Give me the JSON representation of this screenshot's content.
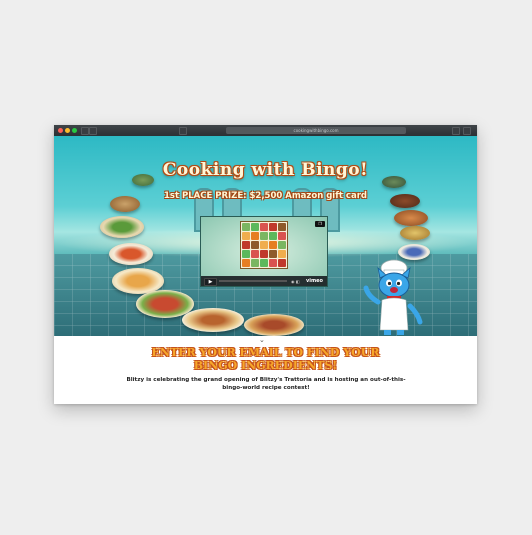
{
  "browser": {
    "url": "cookingwithbingo.com",
    "traffic_lights": [
      "#ff5f57",
      "#febc2e",
      "#28c840"
    ]
  },
  "hero": {
    "title": "Cooking with Bingo!",
    "prize": "1st PLACE PRIZE: $2,500 Amazon gift card"
  },
  "video": {
    "play_icon": "play-icon",
    "provider": "vimeo"
  },
  "content": {
    "cta_line1": "Enter your email to find your",
    "cta_line2": "Bingo ingredients!",
    "description": "Blitzy is celebrating the grand opening of Blitzy's Trattoria and is hosting an out-of-this-bingo-world recipe contest!"
  },
  "colors": {
    "hero_teal": "#2db9c4",
    "title_outline": "#b34d16",
    "cta_orange": "#f7a72b"
  }
}
